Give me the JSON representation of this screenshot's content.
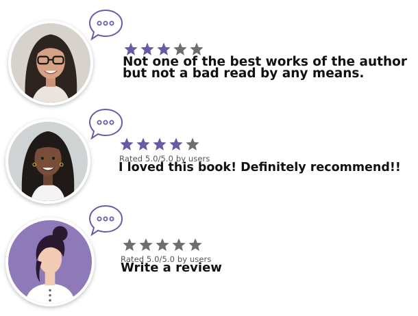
{
  "colors": {
    "accent": "#6a5aa6",
    "star_filled": "#6a5aa6",
    "star_empty": "#6e6e6e",
    "avatar_placeholder_bg": "#8f7ab9"
  },
  "reviews": [
    {
      "avatar": "woman-with-glasses-photo",
      "bubble_icon": "speech-bubble-icon",
      "rating": 3,
      "max_rating": 5,
      "rating_text": "",
      "text_line_1": "Not one of the best works of the author",
      "text_line_2": "but not a bad read by any means."
    },
    {
      "avatar": "woman-with-braids-photo",
      "bubble_icon": "speech-bubble-icon",
      "rating": 4,
      "max_rating": 5,
      "rating_text": "Rated 5.0/5.0 by users",
      "text_line_1": "I loved this book! Definitely recommend!!"
    },
    {
      "avatar": "user-placeholder-avatar",
      "bubble_icon": "speech-bubble-icon",
      "rating": 0,
      "max_rating": 5,
      "rating_text": "Rated 5.0/5.0 by users",
      "text_line_1": "Write a review"
    }
  ]
}
